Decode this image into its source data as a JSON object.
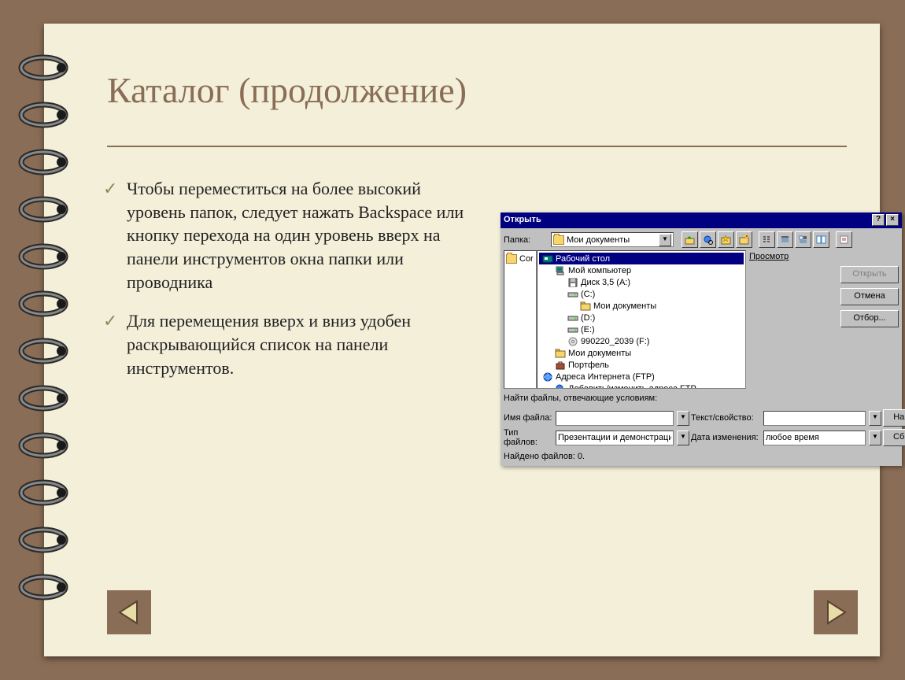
{
  "slide": {
    "title": "Каталог (продолжение)",
    "bullets": [
      "Чтобы переместиться на более высокий уровень папок, следует нажать Backspace или кнопку перехода на один уровень вверх на панели инструментов окна папки или проводника",
      "Для перемещения вверх и вниз удобен раскрывающийся список на панели инструментов."
    ]
  },
  "dialog": {
    "title": "Открыть",
    "help_btn": "?",
    "close_btn": "×",
    "folder_label": "Папка:",
    "folder_value": "Мои документы",
    "tree": {
      "root_folder_short": "Cor",
      "items": [
        {
          "indent": 0,
          "label": "Рабочий стол",
          "icon": "desktop",
          "selected": true
        },
        {
          "indent": 1,
          "label": "Мой компьютер",
          "icon": "computer"
        },
        {
          "indent": 2,
          "label": "Диск 3,5 (A:)",
          "icon": "floppy"
        },
        {
          "indent": 2,
          "label": "(C:)",
          "icon": "drive"
        },
        {
          "indent": 3,
          "label": "Мои документы",
          "icon": "folder"
        },
        {
          "indent": 2,
          "label": "(D:)",
          "icon": "drive"
        },
        {
          "indent": 2,
          "label": "(E:)",
          "icon": "drive"
        },
        {
          "indent": 2,
          "label": "990220_2039 (F:)",
          "icon": "cd"
        },
        {
          "indent": 1,
          "label": "Мои документы",
          "icon": "folder"
        },
        {
          "indent": 1,
          "label": "Портфель",
          "icon": "briefcase"
        },
        {
          "indent": 0,
          "label": "Адреса Интернета (FTP)",
          "icon": "globe"
        },
        {
          "indent": 1,
          "label": "Добавить/изменить адреса FTP",
          "icon": "globe-edit"
        }
      ]
    },
    "buttons": {
      "preview": "Просмотр",
      "open": "Открыть",
      "cancel": "Отмена",
      "filter": "Отбор...",
      "find": "Найти",
      "reset": "Сброс"
    },
    "filters": {
      "header": "Найти файлы, отвечающие условиям:",
      "name_label": "Имя файла:",
      "name_value": "",
      "text_label": "Текст/свойство:",
      "text_value": "",
      "type_label": "Тип файлов:",
      "type_value": "Презентации и демонстрации",
      "date_label": "Дата изменения:",
      "date_value": "любое время"
    },
    "status": "Найдено файлов: 0."
  }
}
